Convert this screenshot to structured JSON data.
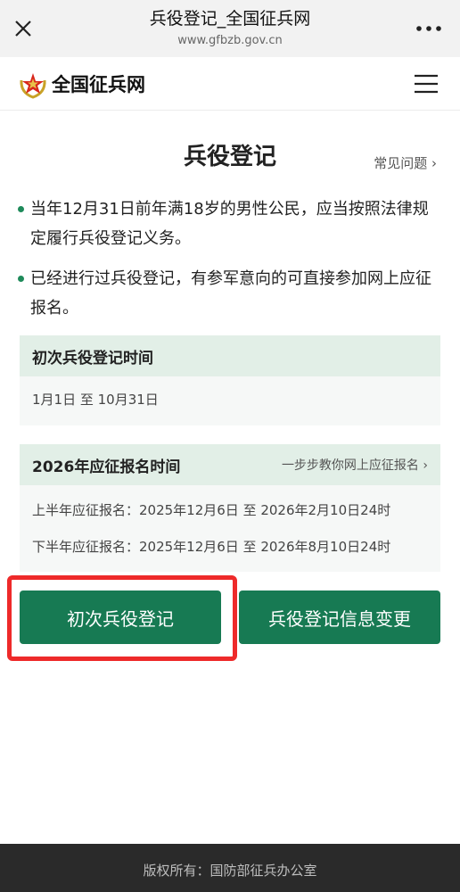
{
  "browser": {
    "title": "兵役登记_全国征兵网",
    "url": "www.gfbzb.gov.cn"
  },
  "site": {
    "name": "全国征兵网"
  },
  "page": {
    "title": "兵役登记",
    "faq_label": "常见问题",
    "bullets": [
      "当年12月31日前年满18岁的男性公民，应当按照法律规定履行兵役登记义务。",
      "已经进行过兵役登记，有参军意向的可直接参加网上应征报名。"
    ]
  },
  "first_registration": {
    "heading": "初次兵役登记时间",
    "period": "1月1日 至 10月31日"
  },
  "enlistment": {
    "heading": "2026年应征报名时间",
    "guide_link": "一步步教你网上应征报名",
    "first_half": "上半年应征报名：2025年12月6日 至 2026年2月10日24时",
    "second_half": "下半年应征报名：2025年12月6日 至 2026年8月10日24时"
  },
  "actions": {
    "first_registration_button": "初次兵役登记",
    "change_info_button": "兵役登记信息变更"
  },
  "footer": {
    "copyright": "版权所有：国防部征兵办公室"
  },
  "colors": {
    "accent_green": "#177a53",
    "highlight_red": "#ee2a2a"
  }
}
